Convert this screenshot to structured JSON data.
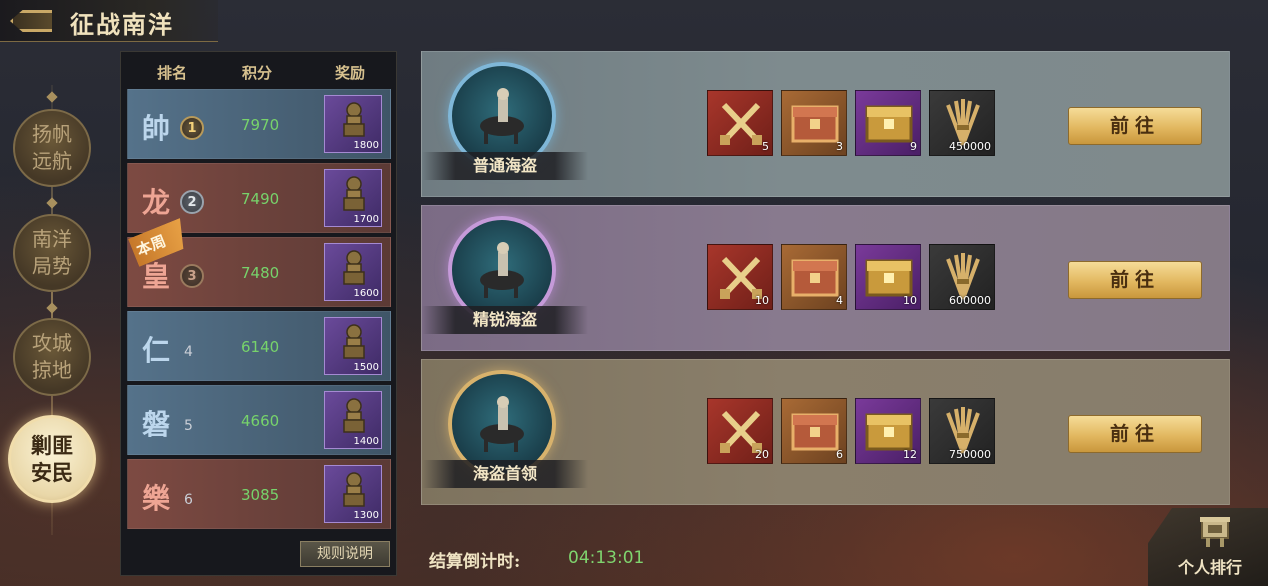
{
  "header": {
    "title": "征战南洋"
  },
  "nav": {
    "items": [
      {
        "label": "扬帆\n远航",
        "active": false
      },
      {
        "label": "南洋\n局势",
        "active": false
      },
      {
        "label": "攻城\n掠地",
        "active": false
      },
      {
        "label": "剿匪\n安民",
        "active": true
      }
    ]
  },
  "ranking": {
    "headers": {
      "rank": "排名",
      "score": "积分",
      "reward": "奖励"
    },
    "week_tag": "本周",
    "rows": [
      {
        "glyph": "帥",
        "rank": "1",
        "score": "7970",
        "reward_qty": "1800",
        "color": "blue"
      },
      {
        "glyph": "龙",
        "rank": "2",
        "score": "7490",
        "reward_qty": "1700",
        "color": "red"
      },
      {
        "glyph": "皇",
        "rank": "3",
        "score": "7480",
        "reward_qty": "1600",
        "color": "red"
      },
      {
        "glyph": "仁",
        "rank": "4",
        "score": "6140",
        "reward_qty": "1500",
        "color": "blue"
      },
      {
        "glyph": "磐",
        "rank": "5",
        "score": "4660",
        "reward_qty": "1400",
        "color": "blue"
      },
      {
        "glyph": "樂",
        "rank": "6",
        "score": "3085",
        "reward_qty": "1300",
        "color": "red"
      }
    ],
    "rules_label": "规则说明"
  },
  "enemies": [
    {
      "name": "普通海盗",
      "rewards": [
        {
          "icon": "crossed-swords-icon",
          "qty": "5"
        },
        {
          "icon": "red-chest-icon",
          "qty": "3"
        },
        {
          "icon": "gold-chest-icon",
          "qty": "9"
        },
        {
          "icon": "grain-sheaf-icon",
          "qty": "450000"
        }
      ],
      "action": "前往"
    },
    {
      "name": "精锐海盗",
      "rewards": [
        {
          "icon": "crossed-swords-icon",
          "qty": "10"
        },
        {
          "icon": "red-chest-icon",
          "qty": "4"
        },
        {
          "icon": "gold-chest-icon",
          "qty": "10"
        },
        {
          "icon": "grain-sheaf-icon",
          "qty": "600000"
        }
      ],
      "action": "前往"
    },
    {
      "name": "海盗首领",
      "rewards": [
        {
          "icon": "crossed-swords-icon",
          "qty": "20"
        },
        {
          "icon": "red-chest-icon",
          "qty": "6"
        },
        {
          "icon": "gold-chest-icon",
          "qty": "12"
        },
        {
          "icon": "grain-sheaf-icon",
          "qty": "750000"
        }
      ],
      "action": "前往"
    }
  ],
  "footer": {
    "countdown_label": "结算倒计时:",
    "countdown_value": "04:13:01",
    "personal_rank_label": "个人排行"
  }
}
